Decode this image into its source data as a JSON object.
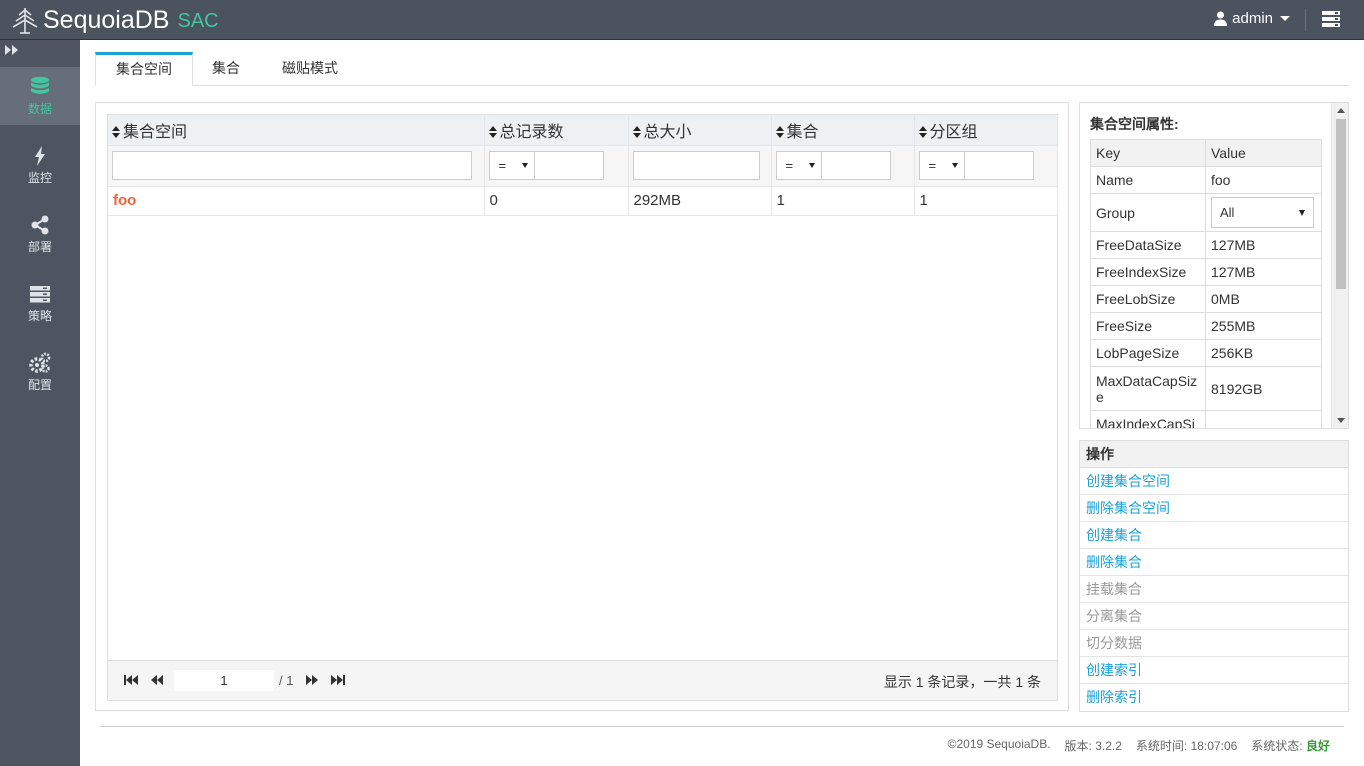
{
  "header": {
    "brand_name": "SequoiaDB",
    "brand_suffix": "SAC",
    "user": "admin"
  },
  "sidebar": {
    "items": [
      {
        "label": "数据",
        "icon": "database-icon",
        "active": true
      },
      {
        "label": "监控",
        "icon": "lightning-icon"
      },
      {
        "label": "部署",
        "icon": "share-icon"
      },
      {
        "label": "策略",
        "icon": "server-icon"
      },
      {
        "label": "配置",
        "icon": "gears-icon"
      }
    ]
  },
  "tabs": [
    "集合空间",
    "集合",
    "磁贴模式"
  ],
  "grid": {
    "columns": [
      "集合空间",
      "总记录数",
      "总大小",
      "集合",
      "分区组"
    ],
    "filter_op": "=",
    "rows": [
      {
        "name": "foo",
        "records": "0",
        "size": "292MB",
        "collections": "1",
        "groups": "1"
      }
    ],
    "pager": {
      "page": "1",
      "total": "/ 1",
      "info": "显示 1 条记录，一共 1 条"
    }
  },
  "properties": {
    "title": "集合空间属性:",
    "key_header": "Key",
    "value_header": "Value",
    "rows": [
      {
        "k": "Name",
        "v": "foo"
      },
      {
        "k": "Group",
        "v": "All"
      },
      {
        "k": "FreeDataSize",
        "v": "127MB"
      },
      {
        "k": "FreeIndexSize",
        "v": "127MB"
      },
      {
        "k": "FreeLobSize",
        "v": "0MB"
      },
      {
        "k": "FreeSize",
        "v": "255MB"
      },
      {
        "k": "LobPageSize",
        "v": "256KB"
      },
      {
        "k": "MaxDataCapSize",
        "v": "8192GB"
      },
      {
        "k": "MaxIndexCapSize",
        "v": ""
      }
    ]
  },
  "operations": {
    "title": "操作",
    "items": [
      {
        "label": "创建集合空间",
        "enabled": true
      },
      {
        "label": "删除集合空间",
        "enabled": true
      },
      {
        "label": "创建集合",
        "enabled": true
      },
      {
        "label": "删除集合",
        "enabled": true
      },
      {
        "label": "挂载集合",
        "enabled": false
      },
      {
        "label": "分离集合",
        "enabled": false
      },
      {
        "label": "切分数据",
        "enabled": false
      },
      {
        "label": "创建索引",
        "enabled": true
      },
      {
        "label": "删除索引",
        "enabled": true
      }
    ]
  },
  "footer": {
    "copyright": "©2019 SequoiaDB.",
    "version": "版本: 3.2.2",
    "time": "系统时间: 18:07:06",
    "status_label": "系统状态:",
    "status_value": "良好"
  },
  "colors": {
    "accent": "#1aa3d9",
    "brand_green": "#43c59e",
    "link_orange": "#f0643c"
  }
}
